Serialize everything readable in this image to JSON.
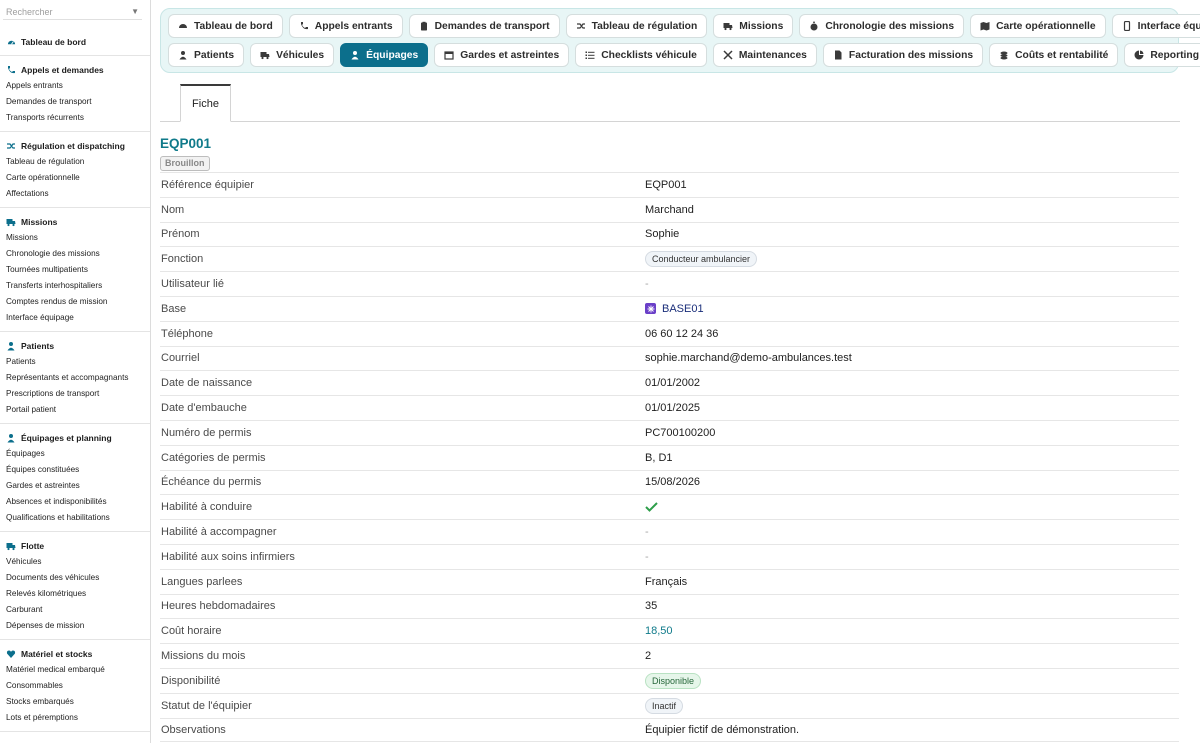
{
  "search": {
    "placeholder": "Rechercher"
  },
  "colors": {
    "accent": "#0c6f8c",
    "title": "#0f7a8a",
    "tabbar_bg": "#e8f6f6",
    "check": "#2e9e4a"
  },
  "sidebar": {
    "top": {
      "label": "Tableau de bord",
      "icon": "dashboard-icon"
    },
    "groups": [
      {
        "title": "Appels et demandes",
        "icon": "phone-icon",
        "items": [
          "Appels entrants",
          "Demandes de transport",
          "Transports récurrents"
        ]
      },
      {
        "title": "Régulation et dispatching",
        "icon": "shuffle-icon",
        "items": [
          "Tableau de régulation",
          "Carte opérationnelle",
          "Affectations"
        ]
      },
      {
        "title": "Missions",
        "icon": "truck-icon",
        "items": [
          "Missions",
          "Chronologie des missions",
          "Tournées multipatients",
          "Transferts interhospitaliers",
          "Comptes rendus de mission",
          "Interface équipage"
        ]
      },
      {
        "title": "Patients",
        "icon": "person-icon",
        "items": [
          "Patients",
          "Représentants et accompagnants",
          "Prescriptions de transport",
          "Portail patient"
        ]
      },
      {
        "title": "Équipages et planning",
        "icon": "person-icon",
        "items": [
          "Équipages",
          "Équipes constituées",
          "Gardes et astreintes",
          "Absences et indisponibilités",
          "Qualifications et habilitations"
        ]
      },
      {
        "title": "Flotte",
        "icon": "truck-icon",
        "items": [
          "Véhicules",
          "Documents des véhicules",
          "Relevés kilométriques",
          "Carburant",
          "Dépenses de mission"
        ]
      },
      {
        "title": "Matériel et stocks",
        "icon": "heart-icon",
        "items": [
          "Matériel medical embarqué",
          "Consommables",
          "Stocks embarqués",
          "Lots et péremptions"
        ]
      }
    ]
  },
  "tabs": {
    "row1": [
      {
        "label": "Tableau de bord",
        "icon": "dashboard-icon"
      },
      {
        "label": "Appels entrants",
        "icon": "phone-icon"
      },
      {
        "label": "Demandes de transport",
        "icon": "clipboard-icon"
      },
      {
        "label": "Tableau de régulation",
        "icon": "shuffle-icon"
      },
      {
        "label": "Missions",
        "icon": "truck-icon"
      },
      {
        "label": "Chronologie des missions",
        "icon": "stopwatch-icon"
      },
      {
        "label": "Carte opérationnelle",
        "icon": "map-icon"
      },
      {
        "label": "Interface équipage",
        "icon": "mobile-icon"
      }
    ],
    "row2": [
      {
        "label": "Patients",
        "icon": "person-icon"
      },
      {
        "label": "Véhicules",
        "icon": "truck-icon"
      },
      {
        "label": "Équipages",
        "icon": "person-icon",
        "active": true
      },
      {
        "label": "Gardes et astreintes",
        "icon": "calendar-icon"
      },
      {
        "label": "Checklists véhicule",
        "icon": "list-icon"
      },
      {
        "label": "Maintenances",
        "icon": "tools-icon"
      },
      {
        "label": "Facturation des missions",
        "icon": "invoice-icon"
      },
      {
        "label": "Coûts et rentabilité",
        "icon": "coins-icon"
      },
      {
        "label": "Reporting",
        "icon": "pie-icon"
      }
    ]
  },
  "subtab": {
    "label": "Fiche"
  },
  "record": {
    "title": "EQP001",
    "status": "Brouillon",
    "fields": [
      {
        "label": "Référence équipier",
        "value": "EQP001",
        "kind": "text"
      },
      {
        "label": "Nom",
        "value": "Marchand",
        "kind": "text"
      },
      {
        "label": "Prénom",
        "value": "Sophie",
        "kind": "text"
      },
      {
        "label": "Fonction",
        "value": "Conducteur ambulancier",
        "kind": "pill"
      },
      {
        "label": "Utilisateur lié",
        "value": "-",
        "kind": "muted"
      },
      {
        "label": "Base",
        "value": "BASE01",
        "kind": "base"
      },
      {
        "label": "Téléphone",
        "value": "06 60 12 24 36",
        "kind": "text"
      },
      {
        "label": "Courriel",
        "value": "sophie.marchand@demo-ambulances.test",
        "kind": "text"
      },
      {
        "label": "Date de naissance",
        "value": "01/01/2002",
        "kind": "text"
      },
      {
        "label": "Date d'embauche",
        "value": "01/01/2025",
        "kind": "text"
      },
      {
        "label": "Numéro de permis",
        "value": "PC700100200",
        "kind": "text"
      },
      {
        "label": "Catégories de permis",
        "value": "B, D1",
        "kind": "text"
      },
      {
        "label": "Échéance du permis",
        "value": "15/08/2026",
        "kind": "text"
      },
      {
        "label": "Habilité à conduire",
        "value": "",
        "kind": "check"
      },
      {
        "label": "Habilité à accompagner",
        "value": "-",
        "kind": "muted"
      },
      {
        "label": "Habilité aux soins infirmiers",
        "value": "-",
        "kind": "muted"
      },
      {
        "label": "Langues parlees",
        "value": "Français",
        "kind": "text"
      },
      {
        "label": "Heures hebdomadaires",
        "value": "35",
        "kind": "text"
      },
      {
        "label": "Coût horaire",
        "value": "18,50",
        "kind": "link"
      },
      {
        "label": "Missions du mois",
        "value": "2",
        "kind": "text"
      },
      {
        "label": "Disponibilité",
        "value": "Disponible",
        "kind": "pill-green"
      },
      {
        "label": "Statut de l'équipier",
        "value": "Inactif",
        "kind": "pill"
      },
      {
        "label": "Observations",
        "value": "Équipier fictif de démonstration.",
        "kind": "text"
      }
    ]
  }
}
